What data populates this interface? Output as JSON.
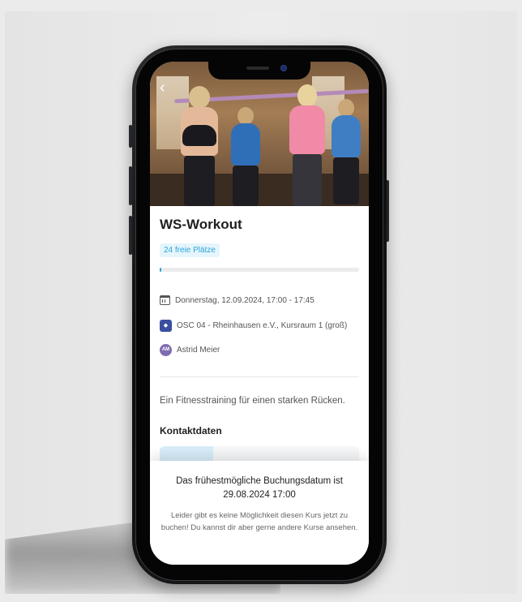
{
  "course": {
    "title": "WS-Workout",
    "free_spots": "24 freie Plätze",
    "fill_level": 0.01,
    "datetime": "Donnerstag, 12.09.2024, 17:00 - 17:45",
    "location": "OSC 04 - Rheinhausen e.V., Kursraum 1 (groß)",
    "trainer_initials": "AM",
    "trainer_name": "Astrid Meier",
    "description": "Ein Fitnesstraining für einen starken Rücken.",
    "contact_heading": "Kontaktdaten"
  },
  "notice": {
    "title": "Das frühestmögliche Buchungsdatum ist 29.08.2024 17:00",
    "text": "Leider gibt es keine Möglichkeit diesen Kurs jetzt zu buchen! Du kannst dir aber gerne andere Kurse ansehen."
  },
  "icons": {
    "back": "chevron-left-icon",
    "calendar": "calendar-icon",
    "club": "club-logo",
    "trainer": "avatar"
  },
  "colors": {
    "accent": "#2aa6d9",
    "badge_bg": "#e6f5fc",
    "avatar": "#7f6bb0"
  }
}
